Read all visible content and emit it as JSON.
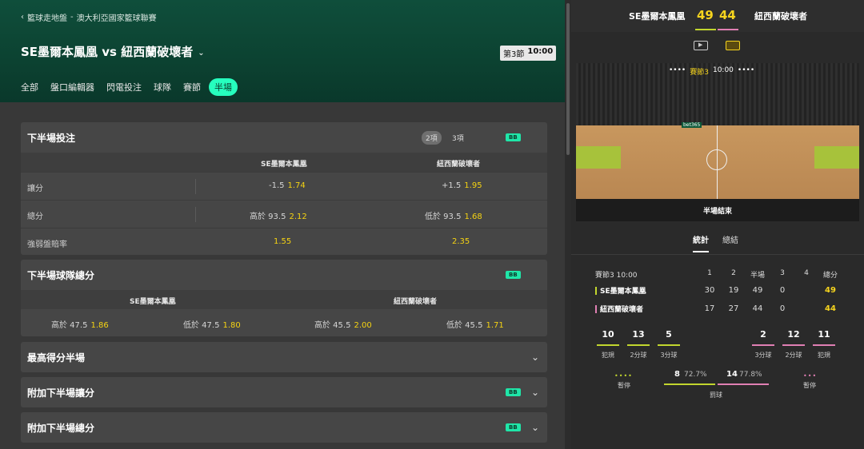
{
  "breadcrumb": {
    "prefix": "籃球走地盤",
    "separator": "-",
    "league": "澳大利亞國家籃球聯賽"
  },
  "match": {
    "title": "SE墨爾本鳳凰 vs 紐西蘭破壞者",
    "period": "第3節",
    "clock": "10:00"
  },
  "tabs": [
    "全部",
    "盤口編輯器",
    "閃電投注",
    "球隊",
    "賽節",
    "半場"
  ],
  "active_tab": "半場",
  "second_half": {
    "title": "下半場投注",
    "pill_a": "2項",
    "pill_b": "3項",
    "badge": "BB",
    "home": "SE墨爾本鳳凰",
    "away": "紐西蘭破壞者",
    "rows": [
      {
        "label": "讓分",
        "home_line": "-1.5",
        "home_odds": "1.74",
        "away_line": "+1.5",
        "away_odds": "1.95"
      },
      {
        "label": "總分",
        "home_line": "高於 93.5",
        "home_odds": "2.12",
        "away_line": "低於 93.5",
        "away_odds": "1.68"
      },
      {
        "label": "強弱盤賠率",
        "home_line": "",
        "home_odds": "1.55",
        "away_line": "",
        "away_odds": "2.35"
      }
    ]
  },
  "team_totals": {
    "title": "下半場球隊總分",
    "badge": "BB",
    "home": "SE墨爾本鳳凰",
    "away": "紐西蘭破壞者",
    "cells": [
      {
        "line": "高於 47.5",
        "odds": "1.86"
      },
      {
        "line": "低於 47.5",
        "odds": "1.80"
      },
      {
        "line": "高於 45.5",
        "odds": "2.00"
      },
      {
        "line": "低於 45.5",
        "odds": "1.71"
      }
    ]
  },
  "collapsed": [
    {
      "title": "最高得分半場",
      "badge": ""
    },
    {
      "title": "附加下半場讓分",
      "badge": "BB"
    },
    {
      "title": "附加下半場總分",
      "badge": "BB"
    }
  ],
  "scoreboard": {
    "home": "SE墨爾本鳳凰",
    "away": "紐西蘭破壞者",
    "home_score": "49",
    "away_score": "44",
    "home_color": "#c2d62e",
    "away_color": "#e07fb3",
    "court_period": "賽節3",
    "court_clock": "10:00",
    "court_status": "半場結束",
    "sponsor": "bet365"
  },
  "stats_tabs": [
    "統計",
    "總結"
  ],
  "stats": {
    "period_label": "賽節3 10:00",
    "cols": [
      "1",
      "2",
      "半場",
      "3",
      "4",
      "總分"
    ],
    "home_row": [
      "30",
      "19",
      "49",
      "0",
      "",
      "49"
    ],
    "away_row": [
      "17",
      "27",
      "44",
      "0",
      "",
      "44"
    ],
    "home_fouls": "10",
    "home_2pt": "13",
    "home_3pt": "5",
    "away_3pt": "2",
    "away_2pt": "12",
    "away_fouls": "11",
    "lbl_fouls": "犯規",
    "lbl_2pt": "2分球",
    "lbl_3pt": "3分球",
    "timeout": "暫停",
    "ft_home": "8",
    "ft_home_pct": "72.7%",
    "ft_away": "14",
    "ft_away_pct": "77.8%",
    "ft_label": "罰球"
  }
}
